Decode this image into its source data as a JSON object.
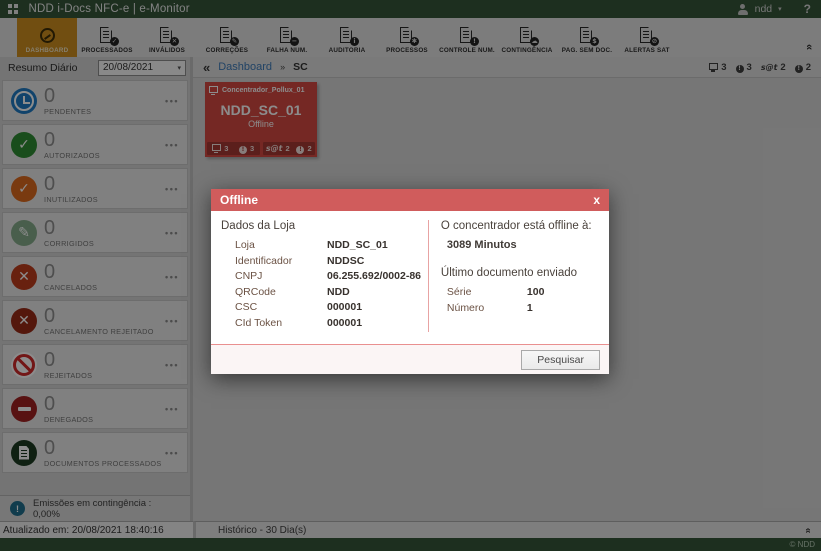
{
  "colors": {
    "brand_green": "#35573A",
    "nav_active_tab": "#CE8F1F",
    "tile_red": "#D64A42",
    "modal_header_red": "#D05C5C",
    "link_blue": "#3D7AB8"
  },
  "icons": {
    "app_menu": "grid",
    "user": "person",
    "user_caret": "caret-down",
    "date_caret": "caret-down",
    "ribbon_collapse": "chevrons-up",
    "sidebar_collapse": "chevrons-left",
    "crumb_sep": "sep-right",
    "history_collapse": "chevrons-up",
    "tile_head": "monitor"
  },
  "header": {
    "title": "NDD i-Docs NFC-e | e-Monitor",
    "user": "ndd",
    "help": "?"
  },
  "nav": {
    "tabs": [
      {
        "label": "DASHBOARD",
        "icon": "gauge"
      },
      {
        "label": "PROCESSADOS",
        "icon": "doc-check"
      },
      {
        "label": "INVÁLIDOS",
        "icon": "doc-x"
      },
      {
        "label": "CORREÇÕES",
        "icon": "doc-pencil"
      },
      {
        "label": "FALHA NUM.",
        "icon": "doc-minus"
      },
      {
        "label": "AUDITORIA",
        "icon": "doc-info"
      },
      {
        "label": "PROCESSOS",
        "icon": "doc-gear"
      },
      {
        "label": "CONTROLE NUM.",
        "icon": "doc-alert"
      },
      {
        "label": "CONTINGÊNCIA",
        "icon": "doc-cloud"
      },
      {
        "label": "PAG. SEM DOC.",
        "icon": "doc-coin"
      },
      {
        "label": "ALERTAS SAT",
        "icon": "doc-ban"
      }
    ]
  },
  "sidebar": {
    "summary_label": "Resumo Diário",
    "date": "20/08/2021",
    "counters": [
      {
        "label": "PENDENTES",
        "value": "0",
        "icon": "clock",
        "color": "#1F7BC4"
      },
      {
        "label": "AUTORIZADOS",
        "value": "0",
        "icon": "check",
        "color": "#2F8C34"
      },
      {
        "label": "INUTILIZADOS",
        "value": "0",
        "icon": "check",
        "color": "#DD6A1E"
      },
      {
        "label": "CORRIGIDOS",
        "value": "0",
        "icon": "pencil",
        "color": "#86AC8B"
      },
      {
        "label": "CANCELADOS",
        "value": "0",
        "icon": "x",
        "color": "#BE3C1C"
      },
      {
        "label": "CANCELAMENTO REJEITADO",
        "value": "0",
        "icon": "x",
        "color": "#9A2A16"
      },
      {
        "label": "REJEITADOS",
        "value": "0",
        "icon": "ban",
        "color": "#D02A2A"
      },
      {
        "label": "DENEGADOS",
        "value": "0",
        "icon": "minus",
        "color": "#A02121"
      },
      {
        "label": "DOCUMENTOS PROCESSADOS",
        "value": "0",
        "icon": "docw",
        "color": "#1C3B22"
      }
    ],
    "contingency": {
      "text": "Emissões em contingência : 0,00%",
      "icon": "bang",
      "color": "#1F6E8C"
    },
    "updated": "Atualizado em: 20/08/2021 18:40:16"
  },
  "breadcrumb": {
    "link": "Dashboard",
    "current": "SC",
    "badges": [
      {
        "icon": "monitor",
        "value": "3"
      },
      {
        "icon": "alert",
        "value": "3"
      },
      {
        "icon": "sat",
        "value": "2"
      },
      {
        "icon": "alert",
        "value": "2"
      }
    ]
  },
  "tile": {
    "group": "Concentrador_Pollux_01",
    "name": "NDD_SC_01",
    "status": "Offline",
    "badges_left": [
      {
        "icon": "monitor",
        "value": "3"
      },
      {
        "icon": "alert",
        "value": "3"
      }
    ],
    "badges_right": [
      {
        "icon": "sat",
        "value": "2"
      },
      {
        "icon": "alert",
        "value": "2"
      }
    ]
  },
  "modal": {
    "title": "Offline",
    "close": "x",
    "store": {
      "heading": "Dados da Loja",
      "rows": [
        {
          "label": "Loja",
          "value": "NDD_SC_01"
        },
        {
          "label": "Identificador",
          "value": "NDDSC"
        },
        {
          "label": "CNPJ",
          "value": "06.255.692/0002-86"
        },
        {
          "label": "QRCode",
          "value": "NDD"
        },
        {
          "label": "CSC",
          "value": "000001"
        },
        {
          "label": "CId Token",
          "value": "000001"
        }
      ]
    },
    "offline_info": {
      "heading": "O concentrador está offline à:",
      "duration": "3089 Minutos",
      "last_doc_heading": "Último documento enviado",
      "rows": [
        {
          "label": "Série",
          "value": "100"
        },
        {
          "label": "Número",
          "value": "1"
        }
      ]
    },
    "search_button": "Pesquisar"
  },
  "statusbar": {
    "history": "Histórico - 30 Dia(s)"
  },
  "footer": {
    "copyright": "© NDD"
  }
}
